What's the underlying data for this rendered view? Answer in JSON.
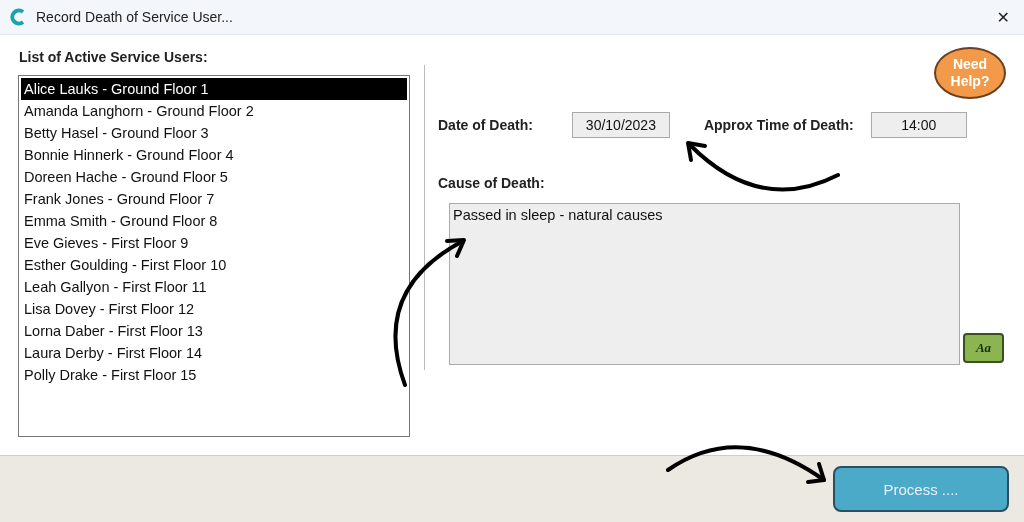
{
  "window": {
    "title": "Record Death of Service User...",
    "close": "✕"
  },
  "list": {
    "label": "List of Active Service Users:",
    "items": [
      {
        "text": "Alice Lauks - Ground Floor 1",
        "selected": true
      },
      {
        "text": "Amanda Langhorn - Ground Floor 2",
        "selected": false
      },
      {
        "text": "Betty Hasel - Ground Floor 3",
        "selected": false
      },
      {
        "text": "Bonnie Hinnerk - Ground Floor 4",
        "selected": false
      },
      {
        "text": "Doreen Hache - Ground Floor 5",
        "selected": false
      },
      {
        "text": "Frank Jones - Ground Floor 7",
        "selected": false
      },
      {
        "text": "Emma Smith - Ground Floor 8",
        "selected": false
      },
      {
        "text": "Eve Gieves - First Floor 9",
        "selected": false
      },
      {
        "text": "Esther Goulding - First Floor 10",
        "selected": false
      },
      {
        "text": "Leah Gallyon - First Floor 11",
        "selected": false
      },
      {
        "text": "Lisa Dovey - First Floor 12",
        "selected": false
      },
      {
        "text": "Lorna Daber - First Floor 13",
        "selected": false
      },
      {
        "text": "Laura Derby - First Floor 14",
        "selected": false
      },
      {
        "text": "Polly Drake - First Floor 15",
        "selected": false
      }
    ]
  },
  "help_button": {
    "label": "Need Help?"
  },
  "date_of_death": {
    "label": "Date of Death:",
    "value": "30/10/2023"
  },
  "time_of_death": {
    "label": "Approx Time of Death:",
    "value": "14:00"
  },
  "cause_of_death": {
    "label": "Cause of Death:",
    "value": "Passed in sleep - natural causes"
  },
  "font_button": {
    "label": "Aa"
  },
  "process_button": {
    "label": "Process ...."
  }
}
